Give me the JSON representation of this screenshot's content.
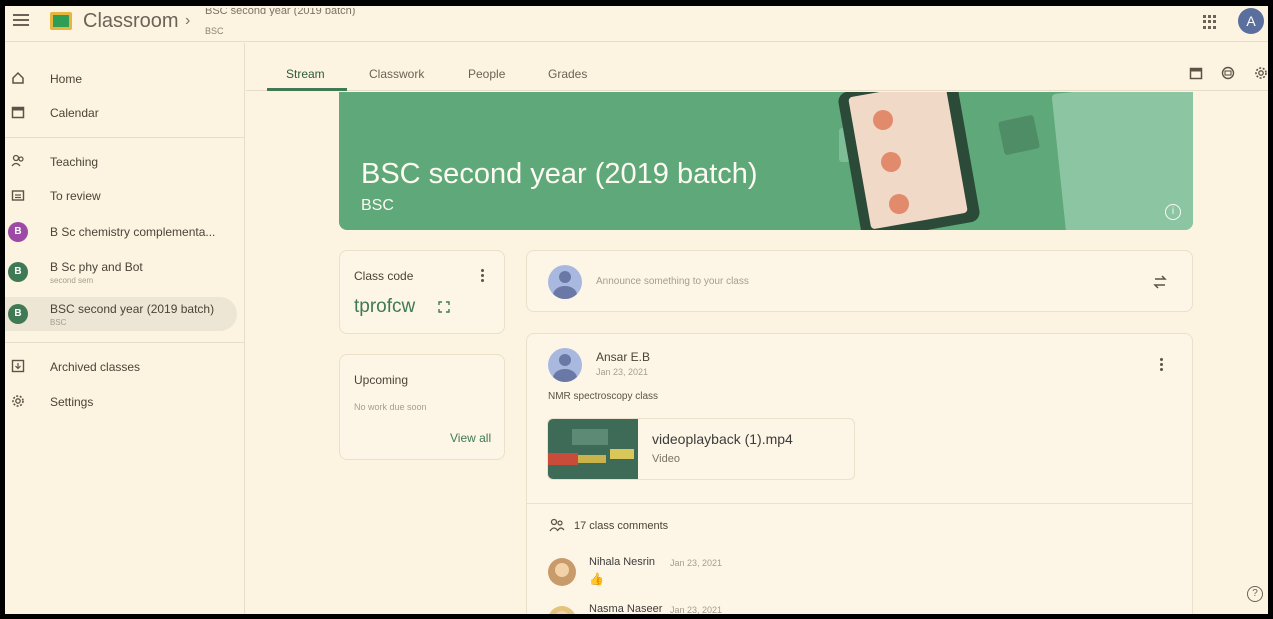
{
  "app": {
    "title": "Classroom",
    "breadcrumb_chevron": "›",
    "class_title_cropped": "BSC second year (2019 batch)",
    "class_section": "BSC",
    "account_initial": "A"
  },
  "sidebar": {
    "items": [
      {
        "label": "Home"
      },
      {
        "label": "Calendar"
      },
      {
        "label": "Teaching"
      },
      {
        "label": "To review"
      },
      {
        "label": "B Sc chemistry complementa...",
        "initial": "B",
        "color": "#9c4aa6"
      },
      {
        "label": "B Sc phy and Bot",
        "sub": "second sem",
        "initial": "B",
        "color": "#3f7a55"
      },
      {
        "label": "BSC second year (2019 batch)",
        "sub": "BSC",
        "initial": "B",
        "color": "#3f7a55"
      },
      {
        "label": "Archived classes"
      },
      {
        "label": "Settings"
      }
    ]
  },
  "tabs": [
    {
      "label": "Stream"
    },
    {
      "label": "Classwork"
    },
    {
      "label": "People"
    },
    {
      "label": "Grades"
    }
  ],
  "banner": {
    "title": "BSC second year (2019 batch)",
    "subtitle": "BSC",
    "info": "i",
    "color": "#5fa87a"
  },
  "class_code": {
    "label": "Class code",
    "code": "tprofcw"
  },
  "upcoming": {
    "title": "Upcoming",
    "note": "No work due soon",
    "link": "View all"
  },
  "announce": {
    "placeholder": "Announce something to your class"
  },
  "post": {
    "author": "Ansar E.B",
    "date": "Jan 23, 2021",
    "body": "NMR spectroscopy class",
    "attachment": {
      "name": "videoplayback (1).mp4",
      "type": "Video"
    },
    "comments_count": "17 class comments",
    "comments": [
      {
        "name": "Nihala Nesrin",
        "date": "Jan 23, 2021",
        "text": "👍"
      },
      {
        "name": "Nasma Naseer",
        "date": "Jan 23, 2021"
      }
    ]
  },
  "help": "?",
  "colors": {
    "accent": "#3f7a55",
    "background": "#fdf3e1"
  }
}
